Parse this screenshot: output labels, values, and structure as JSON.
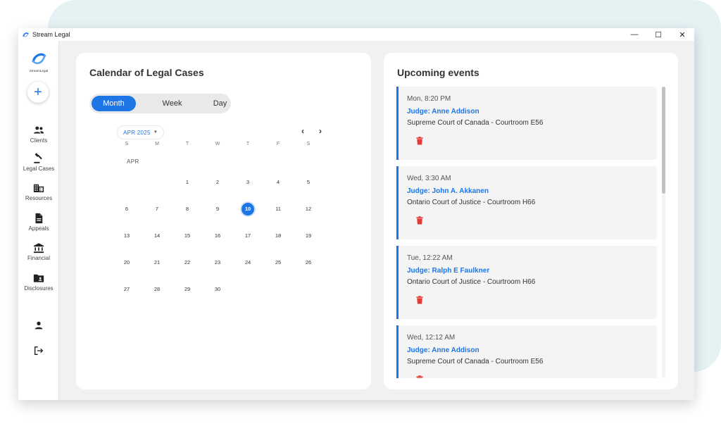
{
  "window": {
    "title": "Stream Legal",
    "minimize": "—",
    "maximize": "☐",
    "close": "✕"
  },
  "sidebar": {
    "brand": "StreamLegal",
    "add_label": "+",
    "items": [
      {
        "label": "Clients",
        "icon": "clients-icon"
      },
      {
        "label": "Legal Cases",
        "icon": "gavel-icon"
      },
      {
        "label": "Resources",
        "icon": "building-icon"
      },
      {
        "label": "Appeals",
        "icon": "document-icon"
      },
      {
        "label": "Financial",
        "icon": "bank-icon"
      },
      {
        "label": "Disclosures",
        "icon": "folder-icon"
      }
    ],
    "profile_icon": "user-icon",
    "logout_icon": "logout-icon"
  },
  "calendar": {
    "title": "Calendar of Legal Cases",
    "views": [
      "Month",
      "Week",
      "Day"
    ],
    "active_view": "Month",
    "month_select": "APR 2025",
    "weekdays": [
      "S",
      "M",
      "T",
      "W",
      "T",
      "F",
      "S"
    ],
    "month_label": "APR",
    "first_weekday": 2,
    "days_in_month": 30,
    "selected_day": 10
  },
  "events": {
    "title": "Upcoming events",
    "items": [
      {
        "time": "Mon, 8:20 PM",
        "judge": "Judge: Anne Addison",
        "court": "Supreme Court of Canada - Courtroom E56"
      },
      {
        "time": "Wed, 3:30 AM",
        "judge": "Judge: John A. Akkanen",
        "court": "Ontario Court of Justice - Courtroom H66"
      },
      {
        "time": "Tue, 12:22 AM",
        "judge": "Judge: Ralph E Faulkner",
        "court": "Ontario Court of Justice - Courtroom H66"
      },
      {
        "time": "Wed, 12:12 AM",
        "judge": "Judge: Anne Addison",
        "court": "Supreme Court of Canada - Courtroom E56"
      }
    ]
  },
  "colors": {
    "accent": "#1e76e6",
    "delete": "#e53935",
    "panel": "#f4f4f4",
    "background": "#f1f1f1"
  }
}
